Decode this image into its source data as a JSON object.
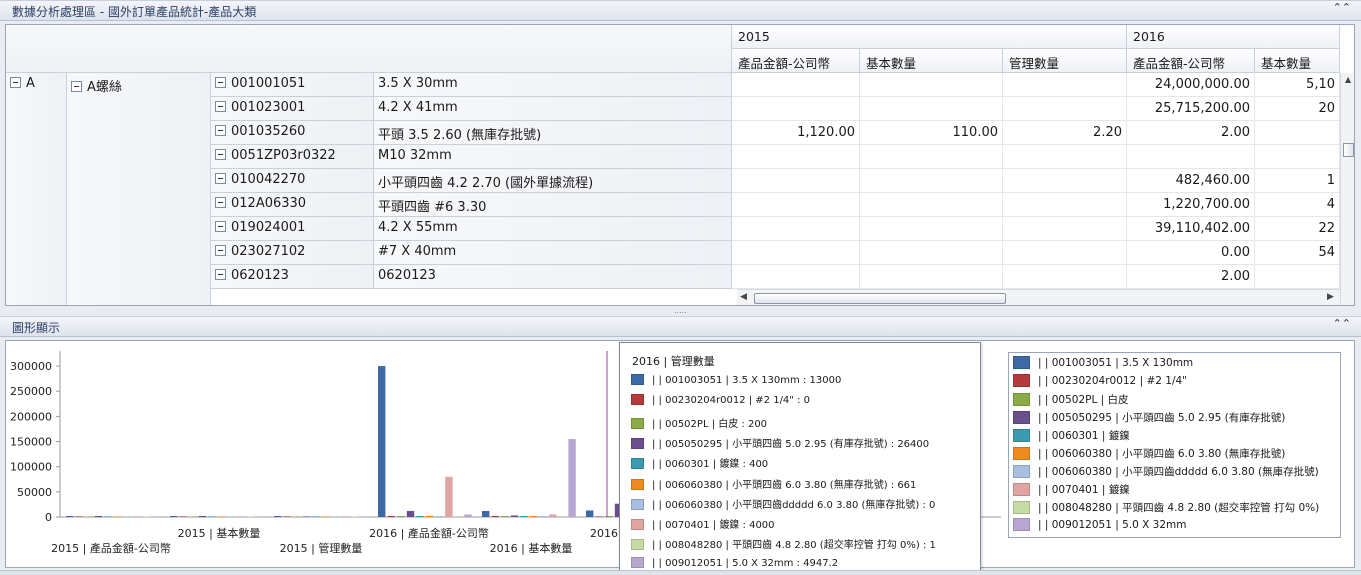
{
  "top_panel": {
    "title": "數據分析處理區 - 國外訂單產品統計-產品大類"
  },
  "bottom_panel": {
    "title": "圖形顯示"
  },
  "grid": {
    "years": [
      "2015",
      "2016"
    ],
    "columns_2015": [
      "產品金額-公司幣",
      "基本數量",
      "管理數量"
    ],
    "columns_2016": [
      "產品金額-公司幣",
      "基本數量"
    ],
    "group_l1": "A",
    "group_l2": "A螺絲",
    "rows": [
      {
        "code": "001001051",
        "desc": "3.5 X 30mm",
        "v15_amt": "",
        "v15_qty": "",
        "v15_mgmt": "",
        "v16_amt": "24,000,000.00",
        "v16_qty": "5,10"
      },
      {
        "code": "001023001",
        "desc": "4.2 X 41mm",
        "v15_amt": "",
        "v15_qty": "",
        "v15_mgmt": "",
        "v16_amt": "25,715,200.00",
        "v16_qty": "20"
      },
      {
        "code": "001035260",
        "desc": "平頭 3.5 2.60 (無庫存批號)",
        "v15_amt": "1,120.00",
        "v15_qty": "110.00",
        "v15_mgmt": "2.20",
        "v16_amt": "2.00",
        "v16_qty": ""
      },
      {
        "code": "0051ZP03r0322",
        "desc": "M10 32mm",
        "v15_amt": "",
        "v15_qty": "",
        "v15_mgmt": "",
        "v16_amt": "",
        "v16_qty": ""
      },
      {
        "code": "010042270",
        "desc": "小平頭四齒 4.2 2.70 (國外單據流程)",
        "v15_amt": "",
        "v15_qty": "",
        "v15_mgmt": "",
        "v16_amt": "482,460.00",
        "v16_qty": "1"
      },
      {
        "code": "012A06330",
        "desc": "平頭四齒 #6 3.30",
        "v15_amt": "",
        "v15_qty": "",
        "v15_mgmt": "",
        "v16_amt": "1,220,700.00",
        "v16_qty": "4"
      },
      {
        "code": "019024001",
        "desc": "4.2 X 55mm",
        "v15_amt": "",
        "v15_qty": "",
        "v15_mgmt": "",
        "v16_amt": "39,110,402.00",
        "v16_qty": "22"
      },
      {
        "code": "023027102",
        "desc": "#7 X 40mm",
        "v15_amt": "",
        "v15_qty": "",
        "v15_mgmt": "",
        "v16_amt": "0.00",
        "v16_qty": "54"
      },
      {
        "code": "0620123",
        "desc": "0620123",
        "v15_amt": "",
        "v15_qty": "",
        "v15_mgmt": "",
        "v16_amt": "2.00",
        "v16_qty": ""
      }
    ]
  },
  "chart_data": {
    "type": "bar",
    "y_ticks": [
      "300000",
      "250000",
      "200000",
      "150000",
      "100000",
      "50000",
      "0"
    ],
    "ylim": [
      0,
      330000
    ],
    "categories": [
      "2015 | 產品金額-公司幣",
      "2015 | 基本數量",
      "2015 | 管理數量",
      "2016 | 產品金額-公司幣",
      "2016 | 基本數量",
      "2016"
    ],
    "x_labels_row1": [
      "2015 | 基本數量",
      "2016 | 產品金額-公司幣",
      "2016"
    ],
    "x_labels_row2": [
      "2015 | 產品金額-公司幣",
      "2015 | 管理數量",
      "2016 | 基本數量"
    ],
    "series": [
      {
        "name": "| | 001003051 | 3.5 X 130mm",
        "color": "#3d6aa6",
        "values": [
          500,
          300,
          100,
          300000,
          12000,
          13000
        ]
      },
      {
        "name": "| | 00230204r0012 | #2 1/4\"",
        "color": "#b23b3b",
        "values": [
          0,
          0,
          0,
          800,
          300,
          0
        ]
      },
      {
        "name": "| | 00502PL | 白皮",
        "color": "#8aac46",
        "values": [
          0,
          0,
          0,
          600,
          200,
          200
        ]
      },
      {
        "name": "| | 005050295 | 小平頭四齒 5.0 2.95 (有庫存批號)",
        "color": "#6c4f8f",
        "values": [
          400,
          200,
          0,
          12000,
          3000,
          26400
        ]
      },
      {
        "name": "| | 0060301 | 鍍鎳",
        "color": "#3a9bb0",
        "values": [
          0,
          0,
          0,
          900,
          300,
          400
        ]
      },
      {
        "name": "| | 006060380 | 小平頭四齒 6.0 3.80 (無庫存批號)",
        "color": "#ee8a1f",
        "values": [
          0,
          0,
          0,
          2500,
          600,
          661
        ]
      },
      {
        "name": "| | 006060380 | 小平頭四齒ddddd 6.0 3.80 (無庫存批號)",
        "color": "#a7bfe0",
        "values": [
          0,
          0,
          0,
          500,
          200,
          0
        ]
      },
      {
        "name": "| | 0070401 | 鍍鎳",
        "color": "#e0a4a2",
        "values": [
          0,
          0,
          0,
          80000,
          5000,
          4000
        ]
      },
      {
        "name": "| | 008048280 | 平頭四齒 4.8 2.80 (超交率控管 打勾  0%)",
        "color": "#c6dba3",
        "values": [
          0,
          0,
          0,
          400,
          200,
          1
        ]
      },
      {
        "name": "| | 009012051 | 5.0 X 32mm",
        "color": "#b9a7d3",
        "values": [
          0,
          0,
          0,
          5000,
          155000,
          4947
        ]
      }
    ]
  },
  "tooltip": {
    "title": "2016 | 管理數量",
    "rows": [
      {
        "text": "| | 001003051 | 3.5 X 130mm  : 13000",
        "color": "#3d6aa6"
      },
      {
        "text": "| | 00230204r0012 | #2 1/4\" : 0",
        "color": "#b23b3b"
      },
      {
        "text": "| | 00502PL | 白皮  : 200",
        "color": "#8aac46"
      },
      {
        "text": "| | 005050295 | 小平頭四齒 5.0 2.95 (有庫存批號) : 26400",
        "color": "#6c4f8f"
      },
      {
        "text": "| | 0060301 | 鍍鎳  : 400",
        "color": "#3a9bb0"
      },
      {
        "text": "| | 006060380 | 小平頭四齒 6.0 3.80 (無庫存批號) : 661",
        "color": "#ee8a1f"
      },
      {
        "text": "| | 006060380 | 小平頭四齒ddddd 6.0 3.80 (無庫存批號) : 0",
        "color": "#a7bfe0"
      },
      {
        "text": "| | 0070401 | 鍍鎳  : 4000",
        "color": "#e0a4a2"
      },
      {
        "text": "| | 008048280 | 平頭四齒 4.8 2.80 (超交率控管 打勾  0%) : 1",
        "color": "#c6dba3"
      },
      {
        "text": "| | 009012051 | 5.0 X 32mm  : 4947.2",
        "color": "#b9a7d3"
      }
    ]
  }
}
